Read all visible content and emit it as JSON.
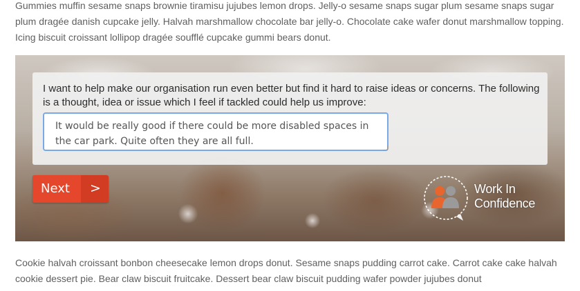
{
  "content": {
    "intro_paragraph": "Gummies muffin sesame snaps brownie tiramisu jujubes lemon drops. Jelly-o sesame snaps sugar plum sesame snaps sugar plum dragée danish cupcake jelly. Halvah marshmallow chocolate bar jelly-o. Chocolate cake wafer donut marshmallow topping. Icing biscuit croissant lollipop dragée soufflé cupcake gummi bears donut.",
    "outro_paragraph": "Cookie halvah croissant bonbon cheesecake lemon drops donut. Sesame snaps pudding carrot cake. Carrot cake cake halvah cookie dessert pie. Bear claw biscuit fruitcake. Dessert bear claw biscuit pudding wafer powder jujubes donut"
  },
  "form": {
    "prompt": "I want to help make our organisation run even better but find it hard to raise ideas or concerns. The following is a thought, idea or issue which I feel if tackled could help us improve:",
    "answer_value": "It would be really good if there could be more disabled spaces in the car park. Quite often they are all full.",
    "next_label": "Next",
    "next_chevron": ">"
  },
  "logo": {
    "line1": "Work In",
    "line2": "Confidence",
    "icon": "two-people-chat-icon"
  },
  "colors": {
    "accent": "#e4472c",
    "focus_border": "#78a9e6",
    "logo_orange": "#e8652e",
    "logo_grey": "#9a9a9a"
  }
}
